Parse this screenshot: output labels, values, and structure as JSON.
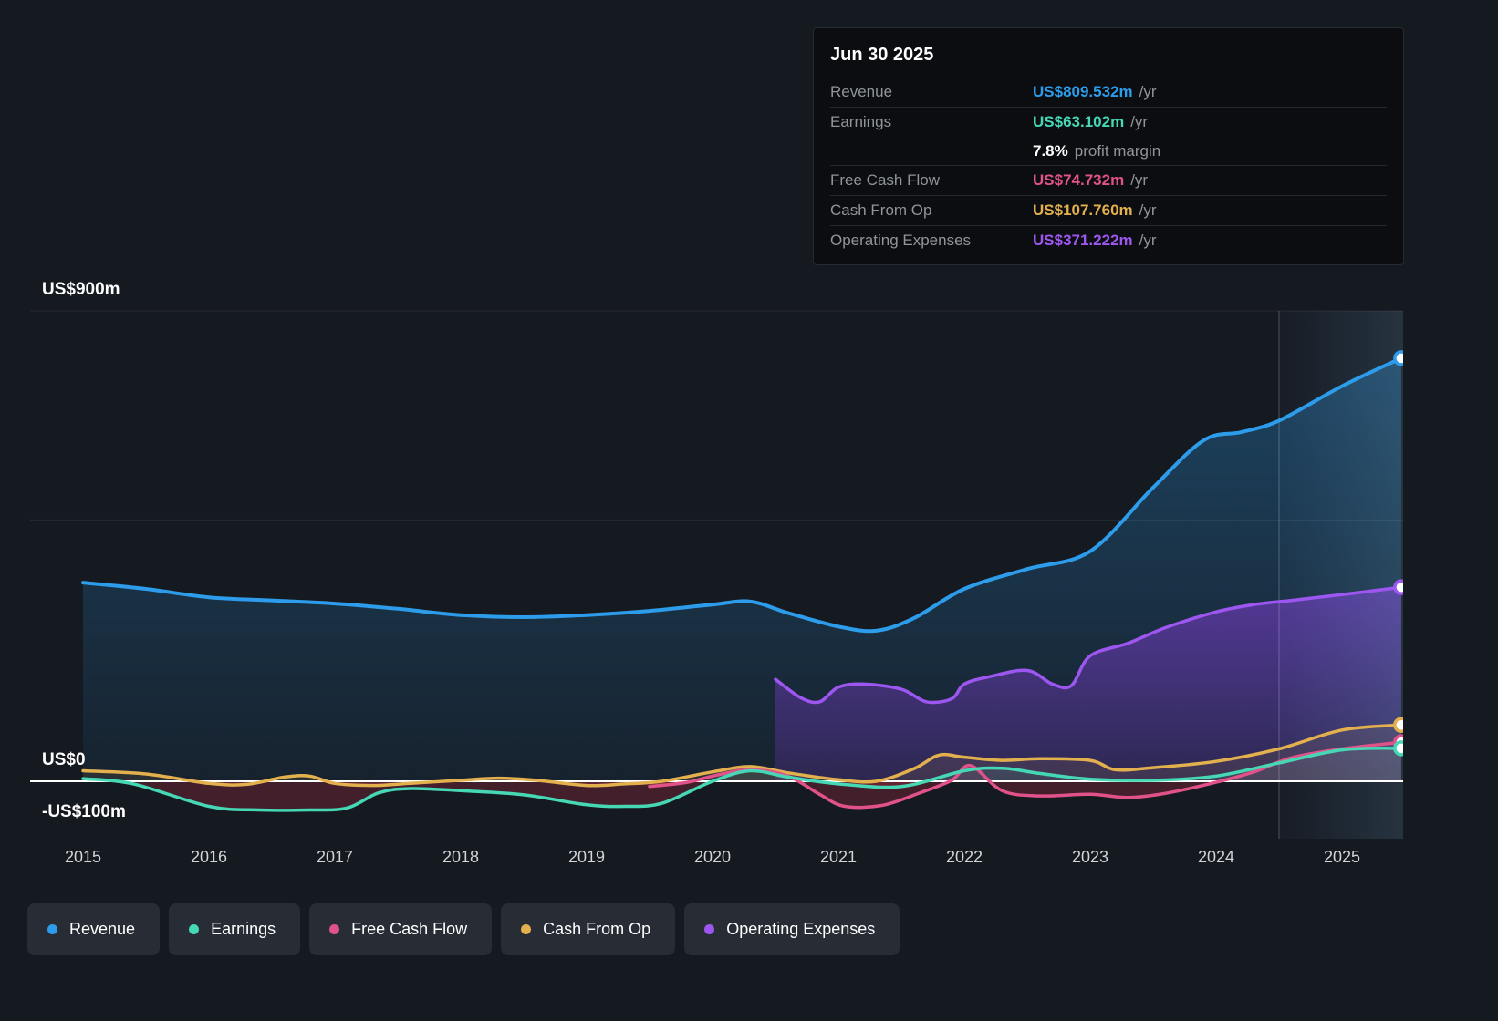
{
  "tooltip": {
    "date": "Jun 30 2025",
    "rows": [
      {
        "label": "Revenue",
        "value": "US$809.532m",
        "suffix": "/yr",
        "color": "#2d9cea",
        "sub": false
      },
      {
        "label": "Earnings",
        "value": "US$63.102m",
        "suffix": "/yr",
        "color": "#46d8b5",
        "sub": false
      },
      {
        "label": "",
        "value": "7.8%",
        "suffix": "profit margin",
        "color": "#ffffff",
        "sub": true
      },
      {
        "label": "Free Cash Flow",
        "value": "US$74.732m",
        "suffix": "/yr",
        "color": "#e2528a",
        "sub": false
      },
      {
        "label": "Cash From Op",
        "value": "US$107.760m",
        "suffix": "/yr",
        "color": "#e3b04e",
        "sub": false
      },
      {
        "label": "Operating Expenses",
        "value": "US$371.222m",
        "suffix": "/yr",
        "color": "#9d57f0",
        "sub": false
      }
    ]
  },
  "axis": {
    "y_labels": [
      {
        "text": "US$900m",
        "value": 900
      },
      {
        "text": "US$0",
        "value": 0
      },
      {
        "text": "-US$100m",
        "value": -100
      }
    ],
    "x_ticks": [
      "2015",
      "2016",
      "2017",
      "2018",
      "2019",
      "2020",
      "2021",
      "2022",
      "2023",
      "2024",
      "2025"
    ]
  },
  "legend": [
    {
      "label": "Revenue",
      "color": "#2d9cea"
    },
    {
      "label": "Earnings",
      "color": "#46d8b5"
    },
    {
      "label": "Free Cash Flow",
      "color": "#e2528a"
    },
    {
      "label": "Cash From Op",
      "color": "#e3b04e"
    },
    {
      "label": "Operating Expenses",
      "color": "#9d57f0"
    }
  ],
  "chart_data": {
    "type": "line",
    "title": "Earnings and Revenue History",
    "unit": "US$ millions per year",
    "x_range": [
      2015,
      2025.5
    ],
    "y_range": [
      -100,
      900
    ],
    "y_gridlines": [
      900,
      500
    ],
    "zero_line": 0,
    "highlight_from": 2024.5,
    "legend_position": "bottom",
    "series": [
      {
        "name": "Revenue",
        "color": "#2d9cea",
        "points": [
          [
            2015,
            380
          ],
          [
            2015.5,
            368
          ],
          [
            2016,
            352
          ],
          [
            2016.5,
            346
          ],
          [
            2017,
            340
          ],
          [
            2017.5,
            330
          ],
          [
            2018,
            318
          ],
          [
            2018.5,
            314
          ],
          [
            2019,
            318
          ],
          [
            2019.5,
            326
          ],
          [
            2020,
            338
          ],
          [
            2020.3,
            344
          ],
          [
            2020.6,
            322
          ],
          [
            2021,
            296
          ],
          [
            2021.3,
            288
          ],
          [
            2021.6,
            312
          ],
          [
            2022,
            368
          ],
          [
            2022.5,
            406
          ],
          [
            2023,
            440
          ],
          [
            2023.5,
            562
          ],
          [
            2023.9,
            652
          ],
          [
            2024.2,
            668
          ],
          [
            2024.5,
            690
          ],
          [
            2025,
            756
          ],
          [
            2025.47,
            809.5
          ]
        ]
      },
      {
        "name": "Earnings",
        "color": "#46d8b5",
        "points": [
          [
            2015,
            5
          ],
          [
            2015.4,
            -5
          ],
          [
            2016,
            -48
          ],
          [
            2016.4,
            -55
          ],
          [
            2016.8,
            -55
          ],
          [
            2017.1,
            -51
          ],
          [
            2017.35,
            -22
          ],
          [
            2017.6,
            -14
          ],
          [
            2018,
            -18
          ],
          [
            2018.5,
            -26
          ],
          [
            2019,
            -45
          ],
          [
            2019.3,
            -48
          ],
          [
            2019.6,
            -42
          ],
          [
            2020,
            0
          ],
          [
            2020.3,
            20
          ],
          [
            2020.6,
            8
          ],
          [
            2021,
            -5
          ],
          [
            2021.5,
            -10
          ],
          [
            2022,
            20
          ],
          [
            2022.3,
            25
          ],
          [
            2022.6,
            15
          ],
          [
            2023,
            4
          ],
          [
            2023.5,
            2
          ],
          [
            2024,
            10
          ],
          [
            2024.5,
            35
          ],
          [
            2025,
            60
          ],
          [
            2025.47,
            63.1
          ]
        ]
      },
      {
        "name": "Free Cash Flow",
        "color": "#e2528a",
        "points": [
          [
            2019.5,
            -10
          ],
          [
            2019.8,
            -2
          ],
          [
            2020,
            10
          ],
          [
            2020.3,
            22
          ],
          [
            2020.6,
            10
          ],
          [
            2020.85,
            -25
          ],
          [
            2021.05,
            -48
          ],
          [
            2021.35,
            -46
          ],
          [
            2021.65,
            -22
          ],
          [
            2021.9,
            2
          ],
          [
            2022.05,
            30
          ],
          [
            2022.3,
            -18
          ],
          [
            2022.6,
            -28
          ],
          [
            2023,
            -25
          ],
          [
            2023.3,
            -31
          ],
          [
            2023.6,
            -23
          ],
          [
            2024,
            -2
          ],
          [
            2024.3,
            18
          ],
          [
            2024.6,
            45
          ],
          [
            2025,
            62
          ],
          [
            2025.47,
            74.7
          ]
        ]
      },
      {
        "name": "Cash From Op",
        "color": "#e3b04e",
        "points": [
          [
            2015,
            20
          ],
          [
            2015.5,
            14
          ],
          [
            2016,
            -4
          ],
          [
            2016.3,
            -6
          ],
          [
            2016.6,
            8
          ],
          [
            2016.8,
            10
          ],
          [
            2017,
            -4
          ],
          [
            2017.3,
            -8
          ],
          [
            2017.6,
            -4
          ],
          [
            2018,
            2
          ],
          [
            2018.3,
            6
          ],
          [
            2018.6,
            2
          ],
          [
            2019,
            -8
          ],
          [
            2019.3,
            -5
          ],
          [
            2019.6,
            0
          ],
          [
            2020,
            18
          ],
          [
            2020.3,
            28
          ],
          [
            2020.6,
            16
          ],
          [
            2021,
            3
          ],
          [
            2021.3,
            0
          ],
          [
            2021.6,
            24
          ],
          [
            2021.8,
            50
          ],
          [
            2022,
            46
          ],
          [
            2022.3,
            40
          ],
          [
            2022.6,
            43
          ],
          [
            2023,
            40
          ],
          [
            2023.2,
            22
          ],
          [
            2023.5,
            26
          ],
          [
            2024,
            38
          ],
          [
            2024.5,
            62
          ],
          [
            2025,
            98
          ],
          [
            2025.47,
            107.8
          ]
        ]
      },
      {
        "name": "Operating Expenses",
        "color": "#9d57f0",
        "points": [
          [
            2020.5,
            195
          ],
          [
            2020.7,
            160
          ],
          [
            2020.85,
            152
          ],
          [
            2021,
            180
          ],
          [
            2021.2,
            186
          ],
          [
            2021.5,
            176
          ],
          [
            2021.7,
            152
          ],
          [
            2021.9,
            158
          ],
          [
            2022,
            186
          ],
          [
            2022.2,
            200
          ],
          [
            2022.5,
            212
          ],
          [
            2022.7,
            186
          ],
          [
            2022.85,
            183
          ],
          [
            2023,
            240
          ],
          [
            2023.3,
            264
          ],
          [
            2023.6,
            294
          ],
          [
            2024,
            324
          ],
          [
            2024.3,
            338
          ],
          [
            2024.6,
            346
          ],
          [
            2025,
            357
          ],
          [
            2025.47,
            371.2
          ]
        ]
      }
    ]
  }
}
